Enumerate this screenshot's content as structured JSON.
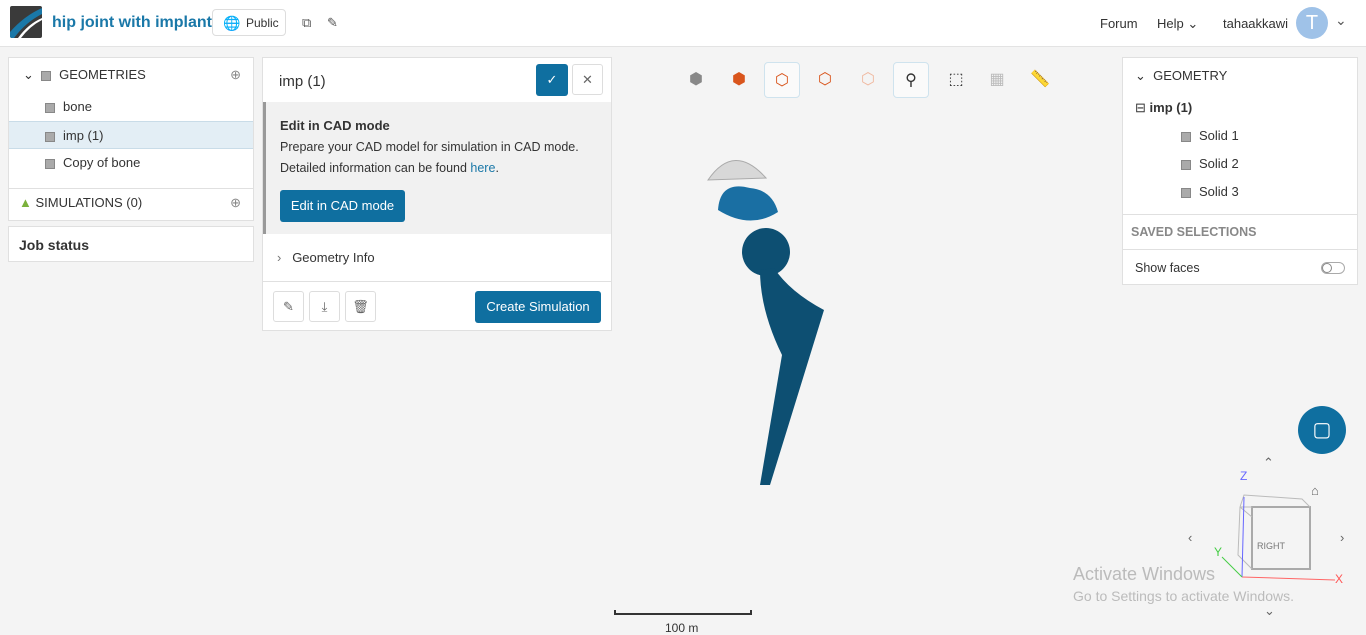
{
  "header": {
    "title": "hip joint with implant",
    "visibility": "Public",
    "forum": "Forum",
    "help": "Help",
    "username": "tahaakkawi",
    "avatar_letter": "T"
  },
  "left_panel": {
    "geometries_label": "GEOMETRIES",
    "items": [
      "bone",
      "imp (1)",
      "Copy of bone"
    ],
    "simulations_label": "SIMULATIONS (0)",
    "job_status": "Job status"
  },
  "detail": {
    "title": "imp (1)",
    "cad_heading": "Edit in CAD mode",
    "cad_text": "Prepare your CAD model for simulation in CAD mode.",
    "cad_text2": "Detailed information can be found ",
    "cad_link": "here",
    "cad_period": ".",
    "cad_button": "Edit in CAD mode",
    "geometry_info": "Geometry Info",
    "create_simulation": "Create Simulation"
  },
  "right_panel": {
    "geometry_label": "GEOMETRY",
    "root": "imp (1)",
    "solids": [
      "Solid 1",
      "Solid 2",
      "Solid 3"
    ],
    "saved_selections": "SAVED SELECTIONS",
    "show_faces": "Show faces",
    "show_faces_on": false
  },
  "viewport": {
    "scale_label": "100 m",
    "view_label": "RIGHT",
    "axes": {
      "x": "X",
      "y": "Y",
      "z": "Z"
    },
    "watermark1": "Activate Windows",
    "watermark2": "Go to Settings to activate Windows."
  },
  "colors": {
    "accent": "#0f6fa0",
    "model": "#0d4f72",
    "model_light": "#1a6fa3"
  }
}
